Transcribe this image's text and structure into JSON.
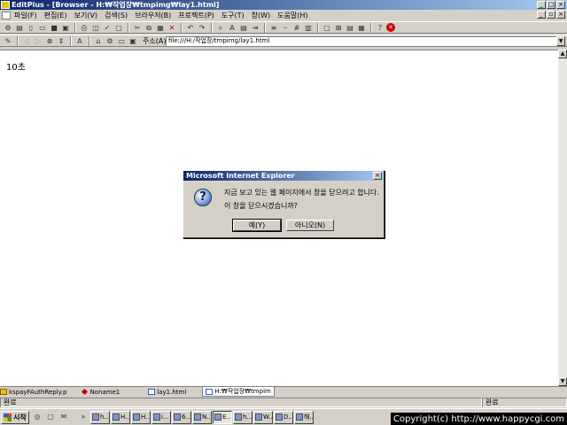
{
  "window": {
    "title": "EditPlus - [Browser - H:₩작업장₩tmpimg₩lay1.html]"
  },
  "menu": {
    "items": [
      "파일(F)",
      "편집(E)",
      "보기(V)",
      "검색(S)",
      "브라우저(B)",
      "프로젝트(P)",
      "도구(T)",
      "창(W)",
      "도움말(H)"
    ]
  },
  "address": {
    "label": "주소(A)",
    "value": "file:///H:/작업장/tmpimg/lay1.html"
  },
  "content": {
    "text": "10초"
  },
  "dialog": {
    "title": "Microsoft Internet Explorer",
    "message_line1": "지금 보고 있는 웹 페이지에서 창을 닫으려고 합니다.",
    "message_line2": "이 창을 닫으시겠습니까?",
    "yes_label": "예(Y)",
    "no_label": "아니오(N)"
  },
  "tabs": [
    {
      "label": "kspayFAuthReply.p"
    },
    {
      "label": "Noname1"
    },
    {
      "label": "lay1.html"
    },
    {
      "label": "H:₩작업장₩tmpim"
    }
  ],
  "status": {
    "left": "완료",
    "right": "완료"
  },
  "taskbar": {
    "start_label": "시작",
    "buttons": [
      "h...",
      "H...",
      "H...",
      "i...",
      "6...",
      "N...",
      "E...",
      "h...",
      "W...",
      "D...",
      "해..."
    ],
    "copyright": "Copyright(c) http://www.happycgi.com"
  },
  "colors": {
    "titlebar_start": "#0a246a",
    "titlebar_end": "#a6caf0",
    "face": "#d4d0c8"
  }
}
